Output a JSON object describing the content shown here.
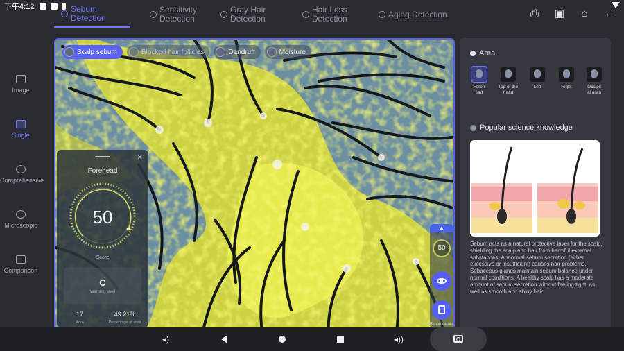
{
  "status_bar": {
    "time": "下午4:12"
  },
  "tabs": [
    {
      "label": "Sebum Detection",
      "active": true
    },
    {
      "label": "Sensitivity Detection",
      "active": false
    },
    {
      "label": "Gray Hair Detection",
      "active": false
    },
    {
      "label": "Hair Loss Detection",
      "active": false
    },
    {
      "label": "Aging Detection",
      "active": false
    }
  ],
  "top_actions": [
    "printer-icon",
    "image-export-icon",
    "home-icon",
    "back-arrow-icon"
  ],
  "sidebar": {
    "items": [
      {
        "label": "Image",
        "icon": "image-icon",
        "active": false
      },
      {
        "label": "Single",
        "icon": "single-chart-icon",
        "active": true
      },
      {
        "label": "Comprehensive",
        "icon": "pie-icon",
        "active": false
      },
      {
        "label": "Microscopic",
        "icon": "microscope-icon",
        "active": false
      },
      {
        "label": "Comparison",
        "icon": "compare-icon",
        "active": false
      }
    ]
  },
  "viewer": {
    "chips": [
      {
        "label": "Scalp sebum",
        "active": true
      },
      {
        "label": "Blocked hair follicles",
        "active": false
      },
      {
        "label": "Dandruff",
        "active": false
      },
      {
        "label": "Moisture",
        "active": false
      }
    ],
    "overlay_color": "#e8e82a"
  },
  "result_card": {
    "area_name": "Forehead",
    "score": "50",
    "score_label": "Score",
    "level": "C",
    "level_label": "Warning level",
    "stats": [
      {
        "value": "17",
        "label": "Area"
      },
      {
        "value": "49.21%",
        "label": "Percentage of area"
      }
    ]
  },
  "floating_controls": {
    "mini_score": "50",
    "report_label": "Report details"
  },
  "panel": {
    "area_title": "Area",
    "areas": [
      {
        "label": "Forehead",
        "active": true
      },
      {
        "label": "Top of the head",
        "active": false
      },
      {
        "label": "Left",
        "active": false
      },
      {
        "label": "Right",
        "active": false
      },
      {
        "label": "Occipital area",
        "active": false
      }
    ],
    "science_title": "Popular science knowledge",
    "science_text": "Sebum acts as a natural protective layer for the scalp, shielding the scalp and hair from harmful external substances. Abnormal sebum secretion (either excessive or insufficient) causes hair problems. Sebaceous glands maintain sebum balance under normal conditions: A healthy scalp has a moderate amount of sebum secretion without feeling tight, as well as smooth and shiny hair."
  },
  "colors": {
    "accent": "#5a64f0",
    "sebum": "#e8e82a",
    "background": "#2a2c31"
  }
}
